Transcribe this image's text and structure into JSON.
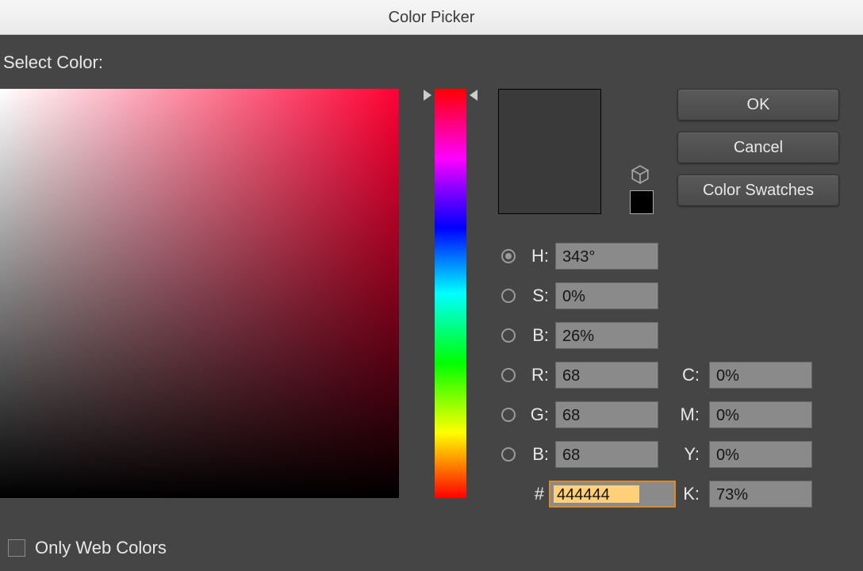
{
  "window": {
    "title": "Color Picker"
  },
  "header": {
    "select_color_label": "Select Color:"
  },
  "buttons": {
    "ok": "OK",
    "cancel": "Cancel",
    "swatches": "Color Swatches"
  },
  "preview": {
    "current": "#3a3a3a",
    "small_swatch": "#000000"
  },
  "hsb": {
    "h": {
      "label": "H:",
      "value": "343°",
      "selected": true
    },
    "s": {
      "label": "S:",
      "value": "0%",
      "selected": false
    },
    "b": {
      "label": "B:",
      "value": "26%",
      "selected": false
    }
  },
  "rgb": {
    "r": {
      "label": "R:",
      "value": "68"
    },
    "g": {
      "label": "G:",
      "value": "68"
    },
    "b": {
      "label": "B:",
      "value": "68"
    }
  },
  "hex": {
    "label": "#",
    "value": "444444"
  },
  "cmyk": {
    "c": {
      "label": "C:",
      "value": "0%"
    },
    "m": {
      "label": "M:",
      "value": "0%"
    },
    "y": {
      "label": "Y:",
      "value": "0%"
    },
    "k": {
      "label": "K:",
      "value": "73%"
    }
  },
  "only_web": {
    "label": "Only Web Colors",
    "checked": false
  }
}
